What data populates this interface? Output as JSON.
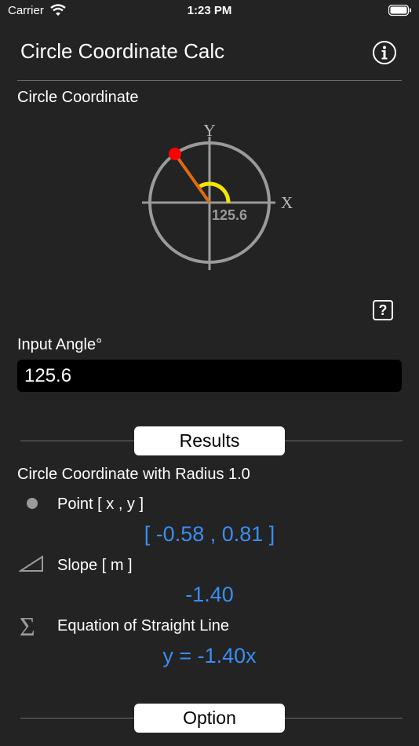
{
  "status_bar": {
    "carrier": "Carrier",
    "time": "1:23 PM"
  },
  "header": {
    "title": "Circle Coordinate Calc"
  },
  "circle_section": {
    "title": "Circle Coordinate",
    "axis_y": "Y",
    "axis_x": "X",
    "angle_label": "125.6"
  },
  "input": {
    "label": "Input Angle°",
    "value": "125.6"
  },
  "results": {
    "header": "Results",
    "subtitle": "Circle Coordinate with Radius 1.0",
    "point_label": "Point [ x , y ]",
    "point_value": "[ -0.58 , 0.81 ]",
    "slope_label": "Slope [ m ]",
    "slope_value": "-1.40",
    "equation_label": "Equation of Straight Line",
    "equation_value": "y = -1.40x"
  },
  "option": {
    "header": "Option"
  },
  "colors": {
    "background": "#232323",
    "accent_blue": "#3a8df0",
    "point_red": "#ff0000",
    "radius_orange": "#e06a10",
    "arc_yellow": "#f2e600",
    "circle_gray": "#9a9a9a"
  }
}
